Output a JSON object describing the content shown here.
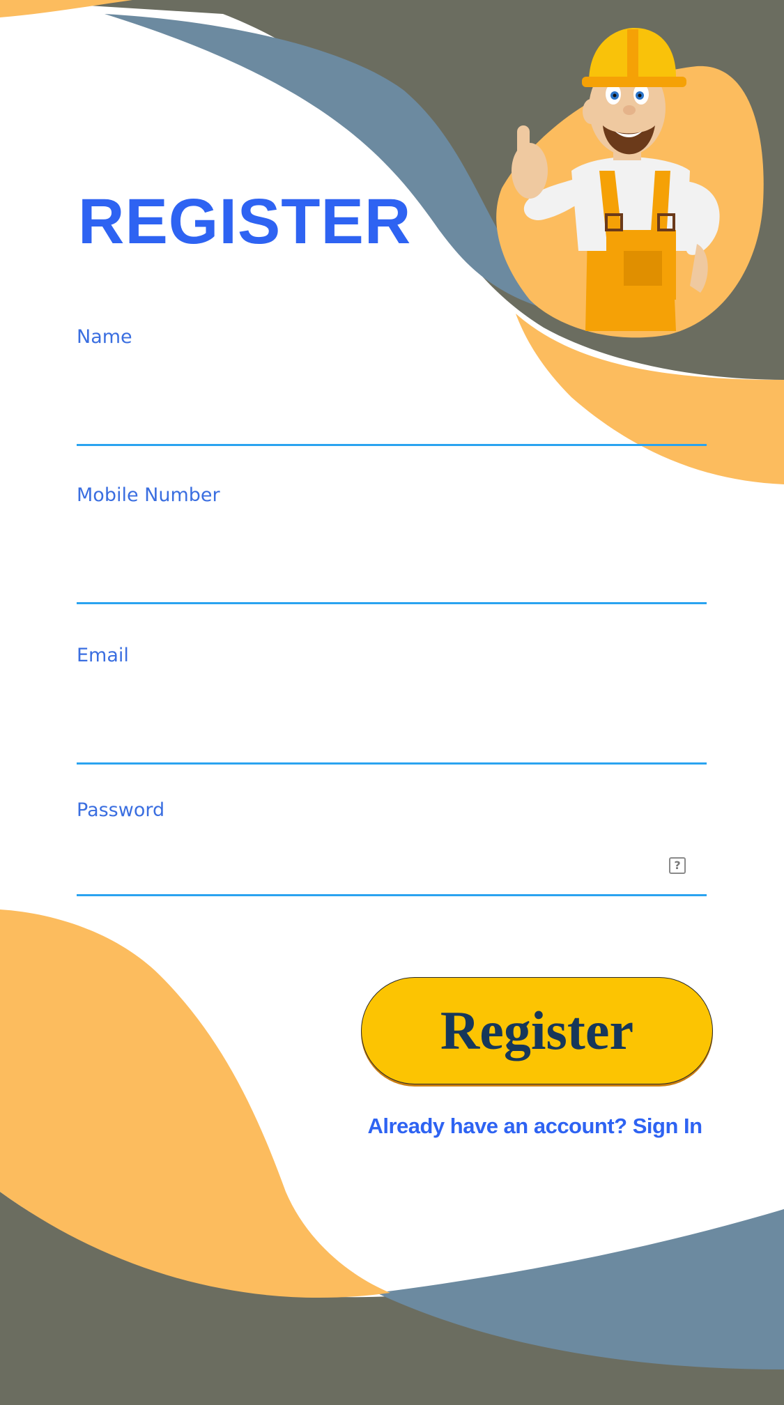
{
  "page": {
    "title": "REGISTER"
  },
  "form": {
    "name": {
      "label": "Name",
      "value": ""
    },
    "mobile": {
      "label": "Mobile Number",
      "value": ""
    },
    "email": {
      "label": "Email",
      "value": ""
    },
    "password": {
      "label": "Password",
      "value": "",
      "help_icon": "?"
    }
  },
  "actions": {
    "register_label": "Register",
    "signin_text": "Already have an account? Sign In"
  },
  "theme": {
    "accent": "#2e63f2",
    "button": "#fcc402",
    "button_text": "#16375a",
    "underline": "#2aa3f0",
    "wave_dark": "#6b6d60",
    "wave_blue": "#6c8aa0",
    "wave_orange": "#fcbc5e"
  },
  "illustration": {
    "icon": "construction-worker-thumbs-up"
  }
}
